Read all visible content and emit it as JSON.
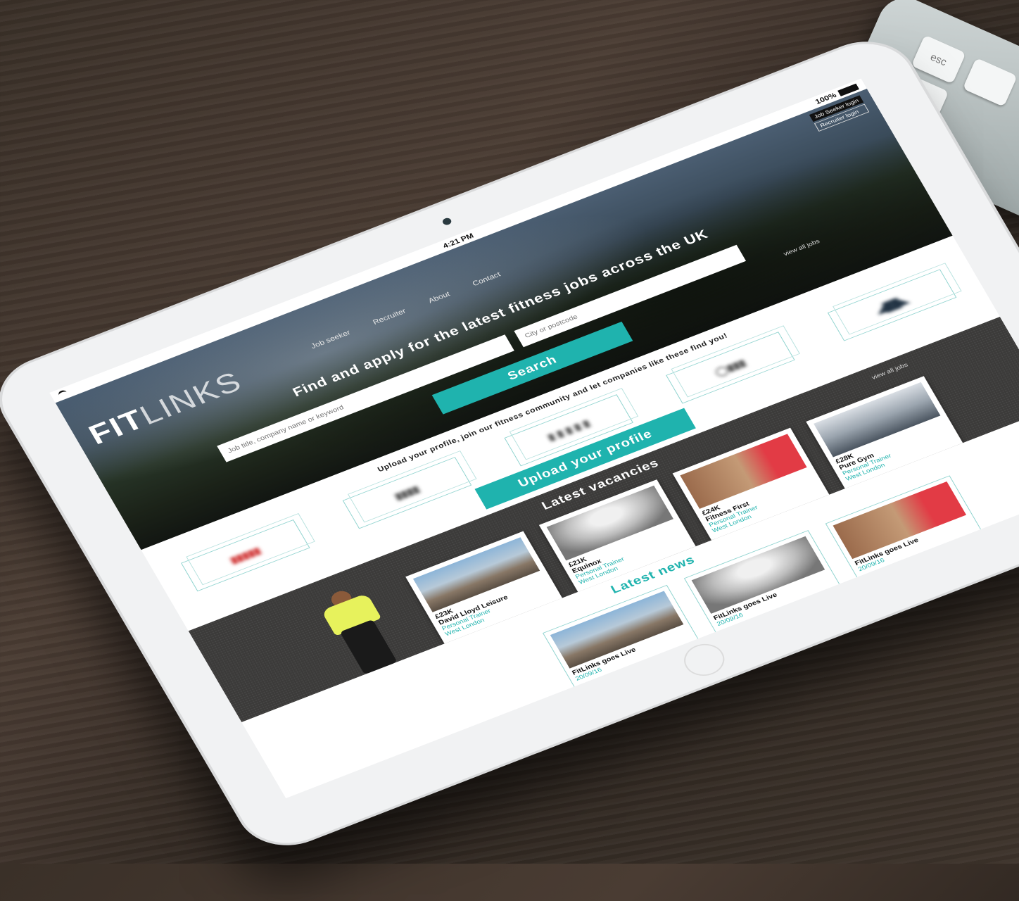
{
  "status_bar": {
    "time": "4:21 PM",
    "battery": "100%"
  },
  "header": {
    "logo_bold": "FIT",
    "logo_light": "LINKS",
    "nav": [
      "Job seeker",
      "Recruiter",
      "About",
      "Contact"
    ],
    "login_jobseeker": "Job Seeker login",
    "login_recruiter": "Recruiter login"
  },
  "hero": {
    "headline": "Find and apply for the latest fitness jobs across the UK",
    "keyword_placeholder": "Job title, company name or keyword",
    "location_placeholder": "City or postcode",
    "view_all": "view all jobs",
    "search_label": "Search"
  },
  "profile": {
    "text": "Upload your profile, join our fitness community and let companies like these find you!",
    "button": "Upload your profile"
  },
  "vacancies": {
    "title": "Latest vacancies",
    "view_all": "view all jobs",
    "items": [
      {
        "salary": "£23K",
        "company": "David Lloyd Leisure",
        "role": "Personal Trainer",
        "location": "West London"
      },
      {
        "salary": "£21K",
        "company": "Equinox",
        "role": "Personal Trainer",
        "location": "West London"
      },
      {
        "salary": "£24K",
        "company": "Fitness First",
        "role": "Personal Trainer",
        "location": "West London"
      },
      {
        "salary": "£28K",
        "company": "Pure Gym",
        "role": "Personal Trainer",
        "location": "West London"
      }
    ]
  },
  "news": {
    "title": "Latest news",
    "items": [
      {
        "title": "FitLinks goes Live",
        "date": "20/09/16"
      },
      {
        "title": "FitLinks goes Live",
        "date": "20/09/16"
      },
      {
        "title": "FitLinks goes Live",
        "date": "20/09/16"
      }
    ]
  },
  "keyboard": {
    "esc_key": "esc"
  },
  "colors": {
    "accent": "#1fb3ae",
    "dark_band": "#3c3b3a"
  }
}
